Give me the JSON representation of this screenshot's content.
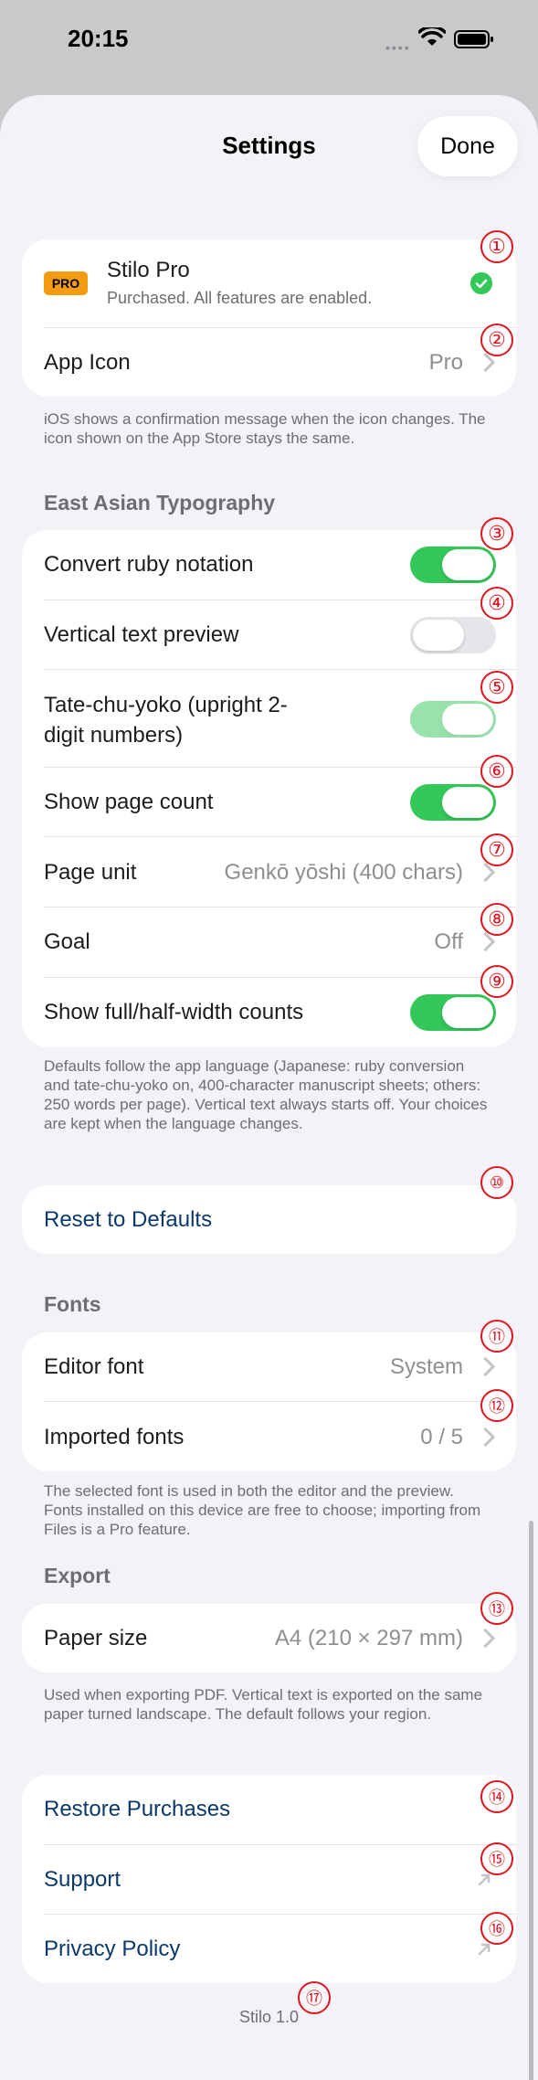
{
  "status_bar": {
    "time": "20:15"
  },
  "nav": {
    "title": "Settings",
    "done_label": "Done"
  },
  "pro": {
    "badge": "PRO",
    "title": "Stilo Pro",
    "subtitle": "Purchased. All features are enabled."
  },
  "app_icon": {
    "label": "App Icon",
    "value": "Pro"
  },
  "app_icon_footer": "iOS shows a confirmation message when the icon changes. The icon shown on the App Store stays the same.",
  "typography": {
    "header": "East Asian Typography",
    "rows": [
      {
        "label": "Convert ruby notation",
        "state": "on"
      },
      {
        "label": "Vertical text preview",
        "state": "off"
      },
      {
        "label": "Tate-chu-yoko (upright 2-",
        "label2": "digit numbers)",
        "state": "on-disabled"
      },
      {
        "label": "Show page count",
        "state": "on"
      },
      {
        "label": "Page unit",
        "value": "Genkō yōshi (400 chars)"
      },
      {
        "label": "Goal",
        "value": "Off"
      },
      {
        "label": "Show full/half-width counts",
        "state": "on"
      }
    ],
    "footer": "Defaults follow the app language (Japanese: ruby conversion and tate-chu-yoko on, 400-character manuscript sheets; others: 250 words per page). Vertical text always starts off. Your choices are kept when the language changes."
  },
  "reset": {
    "label": "Reset to Defaults"
  },
  "fonts": {
    "header": "Fonts",
    "editor_font": {
      "label": "Editor font",
      "value": "System"
    },
    "imported_fonts": {
      "label": "Imported fonts",
      "value": "0 / 5"
    },
    "footer": "The selected font is used in both the editor and the preview. Fonts installed on this device are free to choose; importing from Files is a Pro feature."
  },
  "export": {
    "header": "Export",
    "paper_size": {
      "label": "Paper size",
      "value": "A4 (210 × 297 mm)"
    },
    "footer": "Used when exporting PDF. Vertical text is exported on the same paper turned landscape. The default follows your region."
  },
  "links": {
    "restore": "Restore Purchases",
    "support": "Support",
    "privacy": "Privacy Policy"
  },
  "version": "Stilo 1.0",
  "markers": [
    "①",
    "②",
    "③",
    "④",
    "⑤",
    "⑥",
    "⑦",
    "⑧",
    "⑨",
    "⑩",
    "⑪",
    "⑫",
    "⑬",
    "⑭",
    "⑮",
    "⑯",
    "⑰"
  ],
  "colors": {
    "accent_green": "#34c759",
    "pro_badge": "#f39c12",
    "link": "#0b3a6a",
    "marker": "#e0141e"
  }
}
